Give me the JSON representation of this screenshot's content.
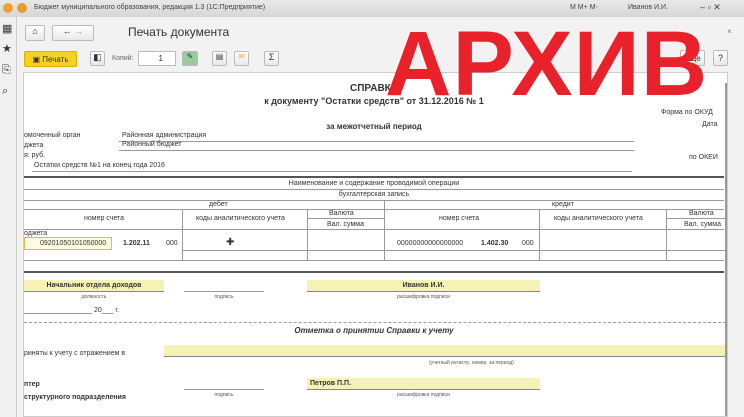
{
  "window": {
    "title": "Бюджет муниципального образования, редакция 1.3  (1С:Предприятие)",
    "user": "Иванов И.И.",
    "mem": [
      "M",
      "M+",
      "M-"
    ]
  },
  "nav": {
    "title": "Печать документа"
  },
  "toolbar": {
    "print_label": "Печать",
    "copies_label": "Копий:",
    "copies_value": "1",
    "more_label": "Еще",
    "help_label": "?"
  },
  "watermark": "АРХИВ",
  "doc": {
    "title": "СПРАВКА",
    "subtitle": "к документу \"Остатки средств\" от 31.12.2016 № 1",
    "period": "за межотчетный период",
    "forma": "Форма  по ОКУД",
    "date": "Дата",
    "okei": "по ОКЕИ",
    "org_label": "омоченный орган",
    "org_value": "Районная администрация",
    "budget_label": "джета",
    "budget_value": "Районный бюджет",
    "unit_label": "я: руб.",
    "basis": "Остатки средств №1 на конец года 2016",
    "table": {
      "h1": "Наименование и содержание проводимой операции",
      "h2": "бухгалтерская запись",
      "debit": "дебет",
      "credit": "кредит",
      "account": "номер счета",
      "codes": "коды аналитического учета",
      "currency": "Валюта",
      "cur_sum": "Вал. сумма",
      "section": "оджета",
      "row": {
        "d_account": "09201050101050000",
        "d_code": "1.202.11",
        "d_kosgu": "000",
        "c_account": "00000000000000000",
        "c_code": "1.402.30",
        "c_kosgu": "000"
      }
    },
    "sign1": {
      "position": "Начальник отдела доходов",
      "position_cap": "должность",
      "sign_cap": "подпись",
      "name": "Иванов И.И.",
      "name_cap": "расшифровка подписи",
      "date": "20___ г."
    },
    "accept_title": "Отметка о принятии Справки к учету",
    "accept_label": "риняты к учету с отражением в",
    "accept_cap": "(учетный регистр, номер, за период)",
    "sign2": {
      "pos1": "птер",
      "pos2": "структурного подразделения",
      "sign_cap": "подпись",
      "name": "Петров П.П.",
      "name_cap": "расшифровка подписи"
    }
  }
}
